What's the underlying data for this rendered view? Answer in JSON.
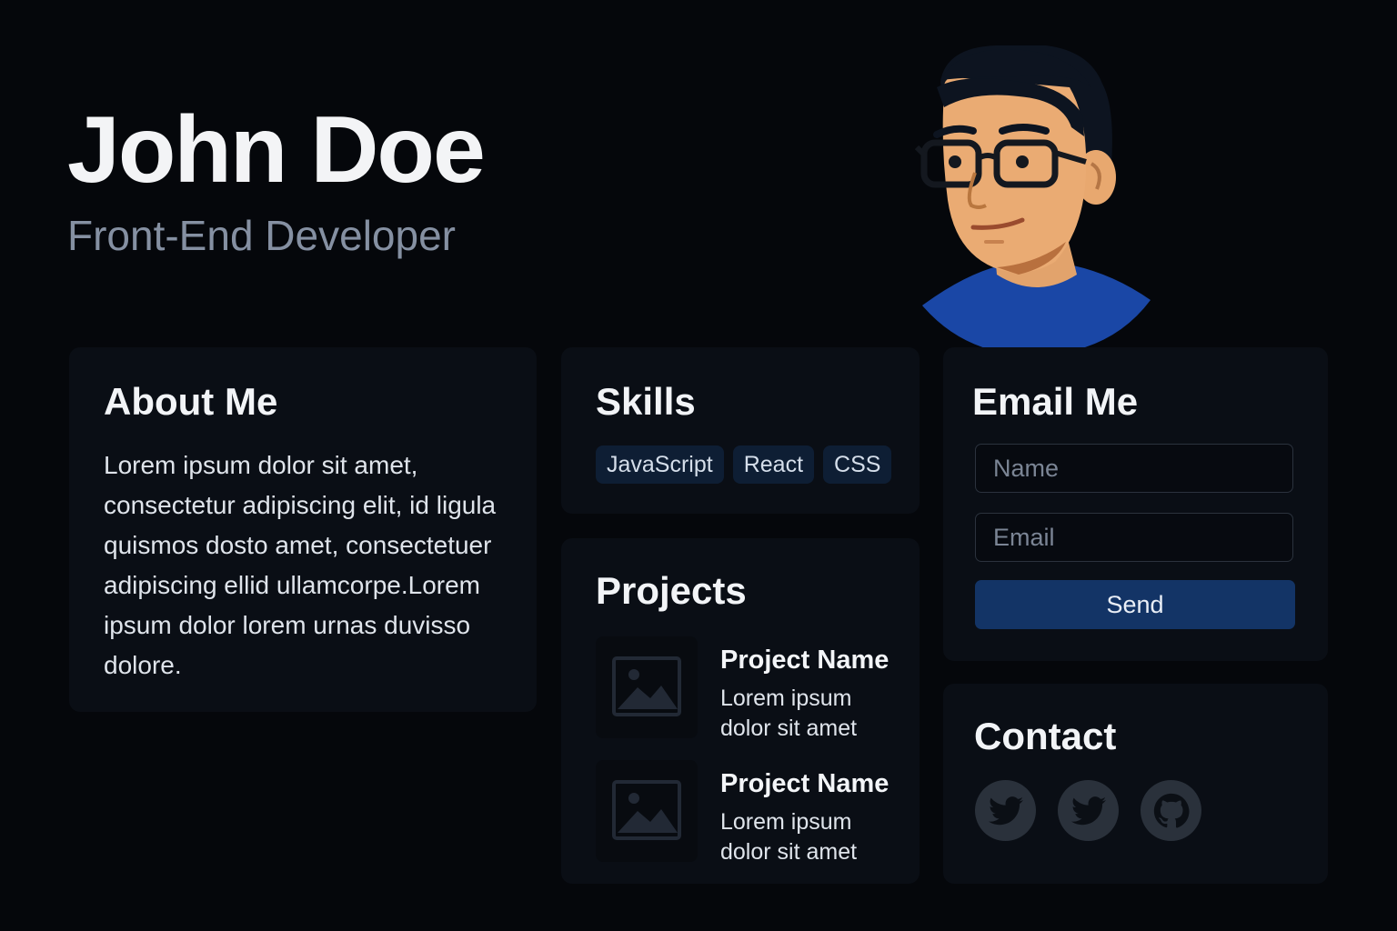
{
  "header": {
    "name": "John Doe",
    "role": "Front-End Developer"
  },
  "avatar": {
    "icon": "developer-avatar-illustration"
  },
  "about": {
    "title": "About Me",
    "text": "Lorem ipsum dolor sit amet, consectetur adipiscing elit, id ligula quismos dosto amet, consectetuer adipiscing ellid ullamcorpe.Lorem ipsum dolor lorem urnas duvisso dolore."
  },
  "skills": {
    "title": "Skills",
    "items": [
      "JavaScript",
      "React",
      "CSS"
    ]
  },
  "projects": {
    "title": "Projects",
    "items": [
      {
        "name": "Project Name",
        "description": "Lorem ipsum dolor sit amet",
        "icon": "image-placeholder-icon"
      },
      {
        "name": "Project Name",
        "description": "Lorem ipsum dolor sit amet",
        "icon": "image-placeholder-icon"
      }
    ]
  },
  "email": {
    "title": "Email Me",
    "name_placeholder": "Name",
    "email_placeholder": "Email",
    "send_label": "Send"
  },
  "contact": {
    "title": "Contact",
    "socials": [
      {
        "icon": "twitter-icon"
      },
      {
        "icon": "twitter-icon"
      },
      {
        "icon": "github-icon"
      }
    ]
  },
  "colors": {
    "background": "#05070b",
    "card": "#0a0e15",
    "accent": "#133466",
    "chip": "#0e1e34",
    "muted_text": "#8590a2"
  }
}
